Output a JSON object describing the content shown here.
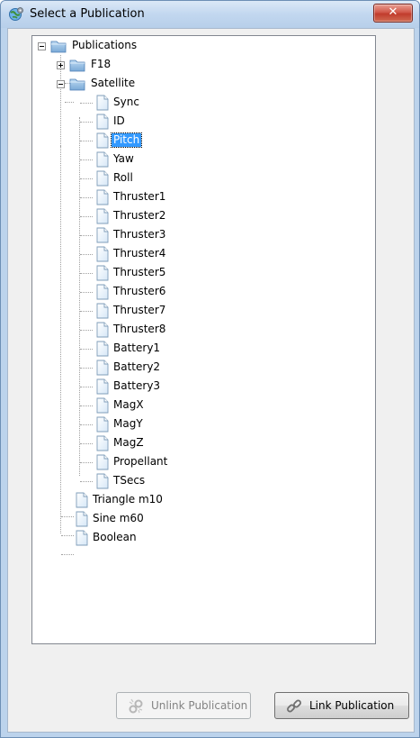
{
  "window": {
    "title": "Select a Publication",
    "close_label": "✕"
  },
  "tree": {
    "nodes": [
      {
        "label": "Publications",
        "kind": "folder",
        "expander": "minus"
      },
      {
        "label": "F18",
        "kind": "folder",
        "expander": "plus"
      },
      {
        "label": "Satellite",
        "kind": "folder",
        "expander": "minus"
      },
      {
        "label": "Sync",
        "kind": "file"
      },
      {
        "label": "ID",
        "kind": "file"
      },
      {
        "label": "Pitch",
        "kind": "file",
        "selected": true
      },
      {
        "label": "Yaw",
        "kind": "file"
      },
      {
        "label": "Roll",
        "kind": "file"
      },
      {
        "label": "Thruster1",
        "kind": "file"
      },
      {
        "label": "Thruster2",
        "kind": "file"
      },
      {
        "label": "Thruster3",
        "kind": "file"
      },
      {
        "label": "Thruster4",
        "kind": "file"
      },
      {
        "label": "Thruster5",
        "kind": "file"
      },
      {
        "label": "Thruster6",
        "kind": "file"
      },
      {
        "label": "Thruster7",
        "kind": "file"
      },
      {
        "label": "Thruster8",
        "kind": "file"
      },
      {
        "label": "Battery1",
        "kind": "file"
      },
      {
        "label": "Battery2",
        "kind": "file"
      },
      {
        "label": "Battery3",
        "kind": "file"
      },
      {
        "label": "MagX",
        "kind": "file"
      },
      {
        "label": "MagY",
        "kind": "file"
      },
      {
        "label": "MagZ",
        "kind": "file"
      },
      {
        "label": "Propellant",
        "kind": "file"
      },
      {
        "label": "TSecs",
        "kind": "file"
      },
      {
        "label": "Triangle m10",
        "kind": "file"
      },
      {
        "label": "Sine m60",
        "kind": "file"
      },
      {
        "label": "Boolean",
        "kind": "file"
      }
    ]
  },
  "buttons": {
    "unlink_label": "Unlink Publication",
    "unlink_enabled": false,
    "link_label": "Link Publication"
  },
  "colors": {
    "selection": "#3399ff",
    "close_button": "#c13c2c",
    "frame": "#bcd3ec"
  }
}
